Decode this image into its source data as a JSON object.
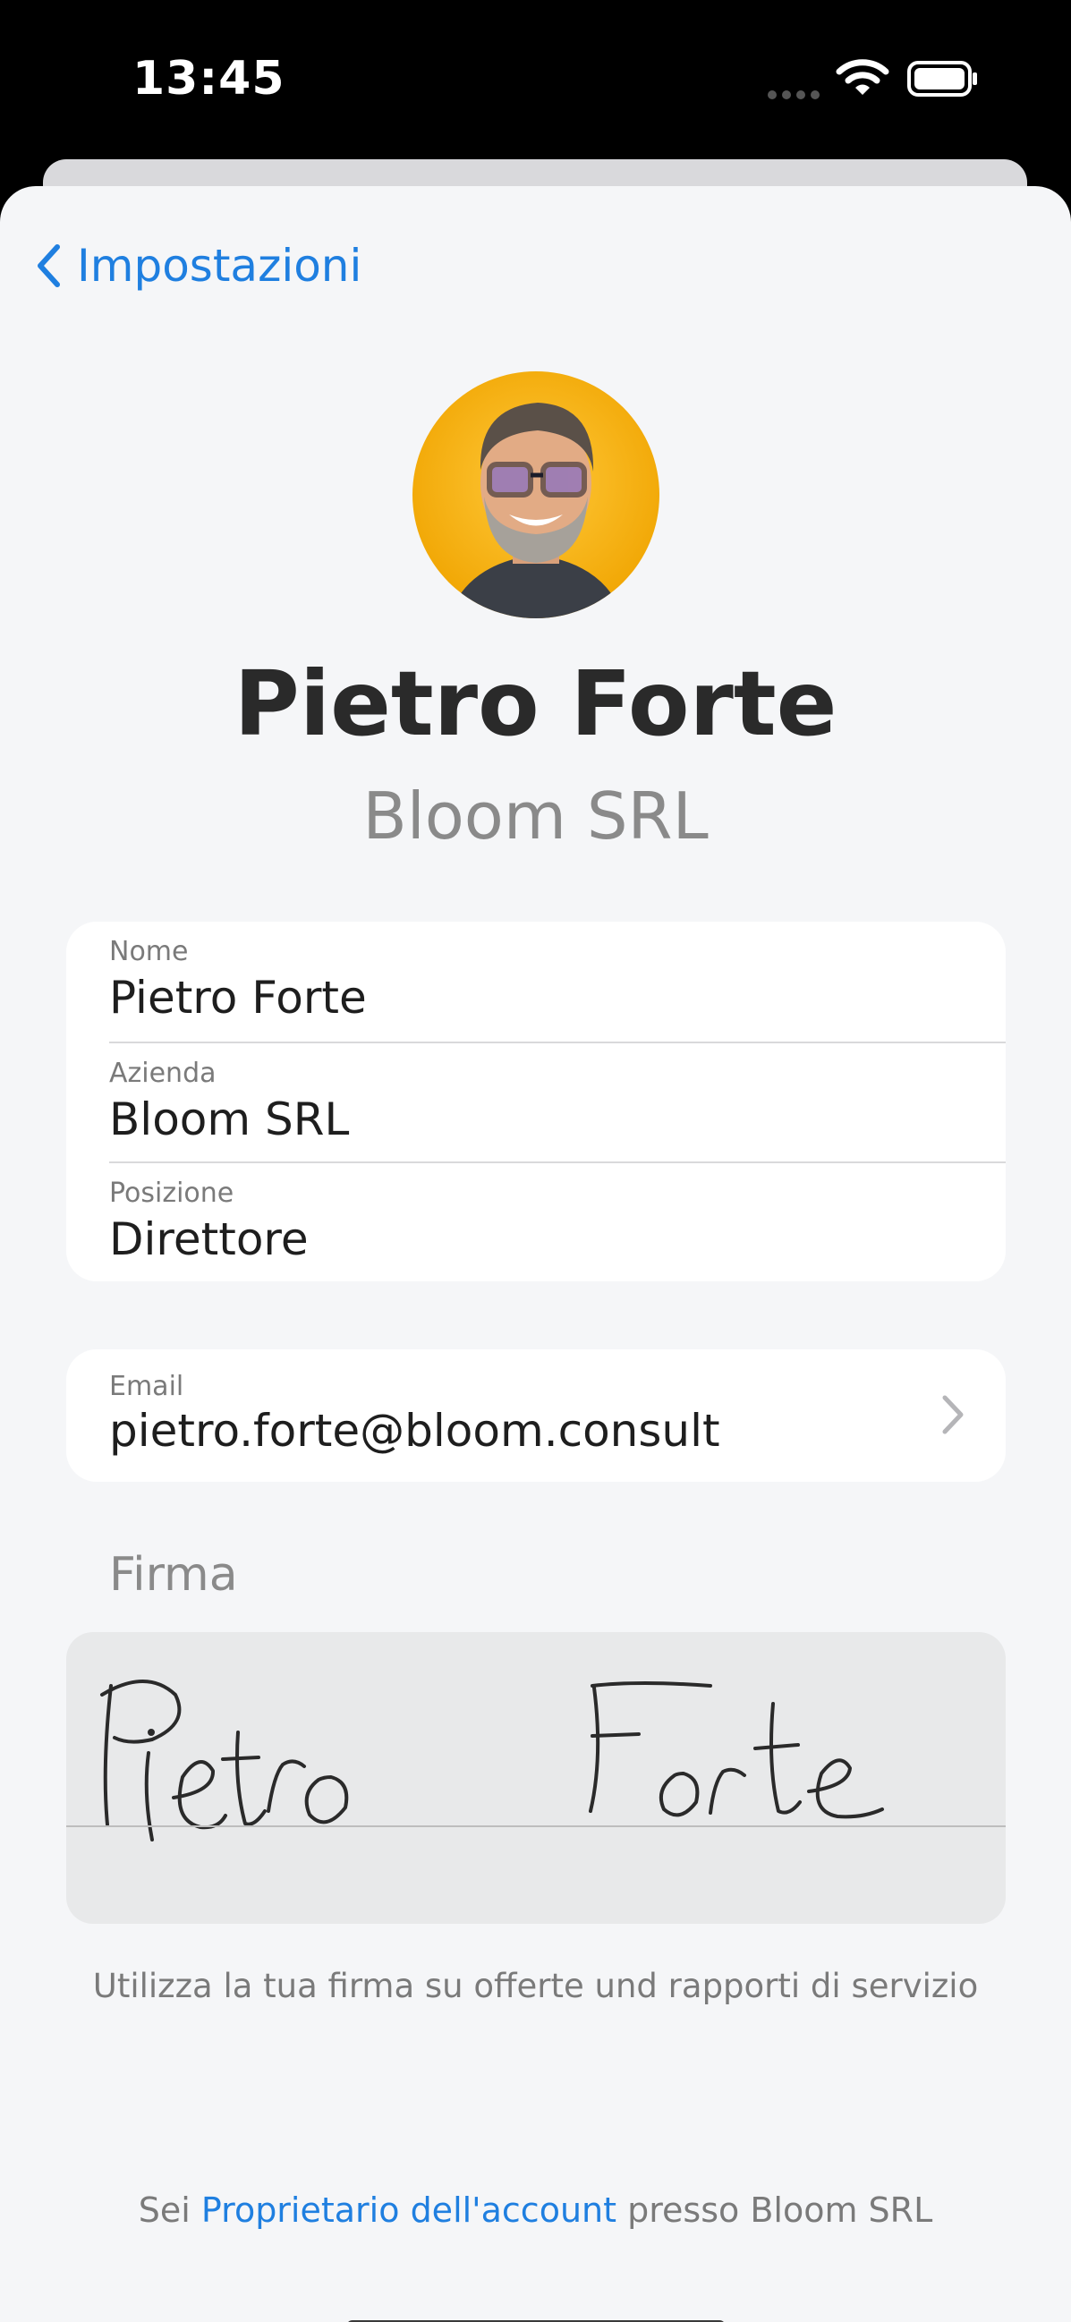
{
  "status_bar": {
    "time": "13:45"
  },
  "nav": {
    "back_label": "Impostazioni"
  },
  "profile": {
    "name": "Pietro Forte",
    "company": "Bloom SRL"
  },
  "details": [
    {
      "label": "Nome",
      "value": "Pietro Forte"
    },
    {
      "label": "Azienda",
      "value": "Bloom SRL"
    },
    {
      "label": "Posizione",
      "value": "Direttore"
    }
  ],
  "email": {
    "label": "Email",
    "value": "pietro.forte@bloom.consult"
  },
  "signature": {
    "section_label": "Firma",
    "hint": "Utilizza la tua firma su offerte und rapporti di servizio",
    "handwritten_text": "Pietro Forte"
  },
  "footer": {
    "prefix": "Sei",
    "role_link": "Proprietario dell'account",
    "suffix": "presso Bloom SRL"
  },
  "colors": {
    "accent": "#1f7fe0",
    "background": "#f5f6f8",
    "card": "#ffffff",
    "signature_box": "#e8e9ea"
  },
  "icons": [
    "back-chevron-icon",
    "chevron-right-icon",
    "wifi-icon",
    "battery-icon",
    "cellular-signal-icon"
  ]
}
